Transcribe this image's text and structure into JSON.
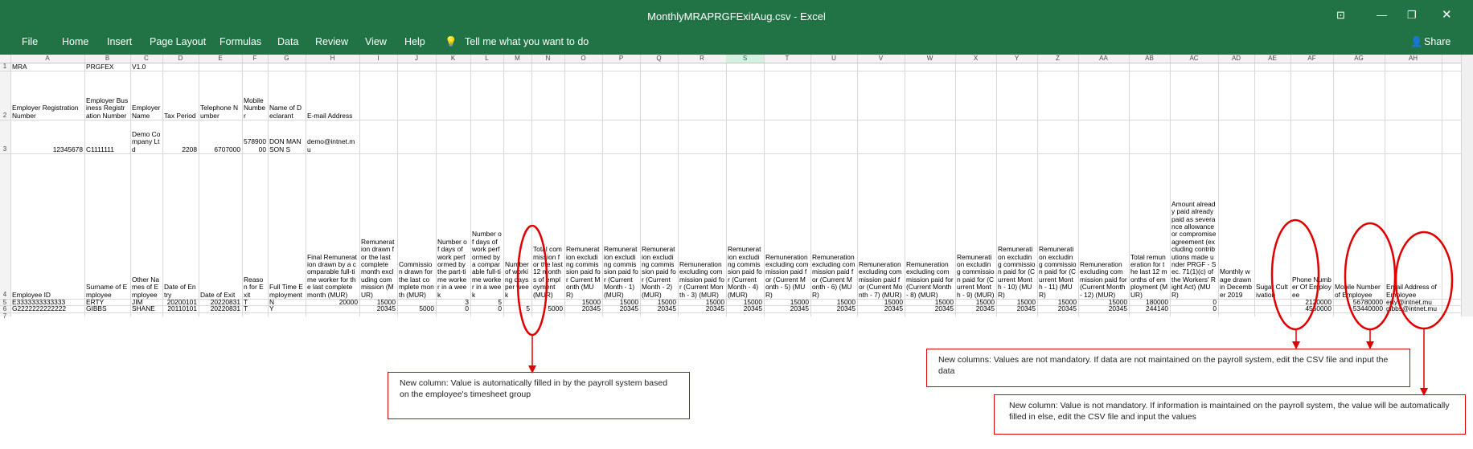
{
  "window": {
    "title": "MonthlyMRAPRGFExitAug.csv  -  Excel"
  },
  "ribbon": {
    "tabs": [
      "File",
      "Home",
      "Insert",
      "Page Layout",
      "Formulas",
      "Data",
      "Review",
      "View",
      "Help"
    ],
    "tell_me": "Tell me what you want to do",
    "share": "Share"
  },
  "columns": [
    "A",
    "B",
    "C",
    "D",
    "E",
    "F",
    "G",
    "H",
    "I",
    "J",
    "K",
    "L",
    "M",
    "N",
    "O",
    "P",
    "Q",
    "R",
    "S",
    "T",
    "U",
    "V",
    "W",
    "X",
    "Y",
    "Z",
    "AA",
    "AB",
    "AC",
    "AD",
    "AE",
    "AF",
    "AG",
    "AH"
  ],
  "row_numbers": [
    "1",
    "2",
    "3",
    "4",
    "5",
    "6",
    "7"
  ],
  "rows": {
    "r1": [
      "MRA",
      "PRGFEX",
      "V1.0",
      "",
      "",
      "",
      "",
      "",
      "",
      "",
      "",
      "",
      "",
      "",
      "",
      "",
      "",
      "",
      "",
      "",
      "",
      "",
      "",
      "",
      "",
      "",
      "",
      "",
      "",
      "",
      "",
      "",
      "",
      ""
    ],
    "r2": [
      "Employer Registration Number",
      "Employer Business Registration Number",
      "Employer Name",
      "Tax Period",
      "Telephone Number",
      "Mobile Number",
      "Name of Declarant",
      "E-mail Address",
      "",
      "",
      "",
      "",
      "",
      "",
      "",
      "",
      "",
      "",
      "",
      "",
      "",
      "",
      "",
      "",
      "",
      "",
      "",
      "",
      "",
      "",
      "",
      "",
      "",
      ""
    ],
    "r3": [
      "12345678",
      "C1111111",
      "Demo Company Ltd",
      "2208",
      "6707000",
      "57890000",
      "DON MANSON S",
      "demo@intnet.mu",
      "",
      "",
      "",
      "",
      "",
      "",
      "",
      "",
      "",
      "",
      "",
      "",
      "",
      "",
      "",
      "",
      "",
      "",
      "",
      "",
      "",
      "",
      "",
      "",
      "",
      ""
    ],
    "r4": [
      "Employee ID",
      "Surname of Employee",
      "Other Names of Employee",
      "Date of Entry",
      "Date of Exit",
      "Reason for Exit",
      "Full Time Employment",
      "Final Remuneration drawn by a comparable full-time worker for the last complete month (MUR)",
      "Remuneration drawn for the last complete month excluding commission (MUR)",
      "Commission drawn for the last complete month (MUR)",
      "Number of days of work performed by the part-time worker in a week",
      "Number of days of work performed by a comparable full-time worker in a week",
      "Number of working days per week",
      "Total commission for the last 12 months of employment (MUR)",
      "Remuneration excluding commission paid for Current Month (MUR)",
      "Remuneration excluding commission paid for (Current Month - 1) (MUR)",
      "Remuneration excluding commission paid for (Current Month - 2) (MUR)",
      "Remuneration excluding commission paid for (Current Month - 3) (MUR)",
      "Remuneration excluding commission paid for (Current Month - 4) (MUR)",
      "Remuneration excluding commission paid for (Current Month - 5) (MUR)",
      "Remuneration excluding commission paid for (Current Month - 6) (MUR)",
      "Remuneration excluding commission paid for (Current Month - 7) (MUR)",
      "Remuneration excluding commission paid for (Current Month - 8) (MUR)",
      "Remuneration excluding commission paid for (Current Month - 9) (MUR)",
      "Remuneration excluding commission paid for (Current Month - 10) (MUR)",
      "Remuneration excluding commission paid for (Current Month - 11) (MUR)",
      "Remuneration excluding commission paid for (Current Month - 12) (MUR)",
      "Total remuneration for the last 12 months of employment (MUR)",
      "Amount already paid already paid as severance allowance or compromise agreement (excluding contributions made under PRGF - Sec. 71(1)(c) of the Workers' Right Act) (MUR)",
      "Monthly wage drawn in December 2019",
      "Sugar Cultivation",
      "Phone Number Of Employee",
      "Mobile Number of Employee",
      "Email Address of Employee"
    ],
    "r5": [
      "E3333333333333",
      "ERTY",
      "JIM",
      "20200101",
      "20220831",
      "T",
      "N",
      "20000",
      "15000",
      "",
      "3",
      "5",
      "",
      "",
      "15000",
      "15000",
      "15000",
      "15000",
      "15000",
      "15000",
      "15000",
      "15000",
      "15000",
      "15000",
      "15000",
      "15000",
      "15000",
      "180000",
      "0",
      "",
      "",
      "2120000",
      "56780000",
      "erty@intnet.mu"
    ],
    "r6": [
      "G2222222222222",
      "GIBBS",
      "SHANE",
      "20110101",
      "20220831",
      "T",
      "Y",
      "",
      "20345",
      "5000",
      "0",
      "0",
      "5",
      "5000",
      "20345",
      "20345",
      "20345",
      "20345",
      "20345",
      "20345",
      "20345",
      "20345",
      "20345",
      "20345",
      "20345",
      "20345",
      "20345",
      "244140",
      "0",
      "",
      "",
      "4560000",
      "53440000",
      "gibbs@intnet.mu"
    ]
  },
  "annotations": {
    "a1": "New column: Value is automatically filled in by the payroll system based on the employee's timesheet group",
    "a2": "New columns: Values are not mandatory. If data are not maintained on the payroll system, edit the CSV file and input the data",
    "a3": "New column: Value is not mandatory. If information is maintained on the payroll system, the value will be automatically filled in else, edit the CSV file and input the values"
  },
  "colors": {
    "excel_green": "#217346",
    "annotation_red": "#e00000"
  }
}
